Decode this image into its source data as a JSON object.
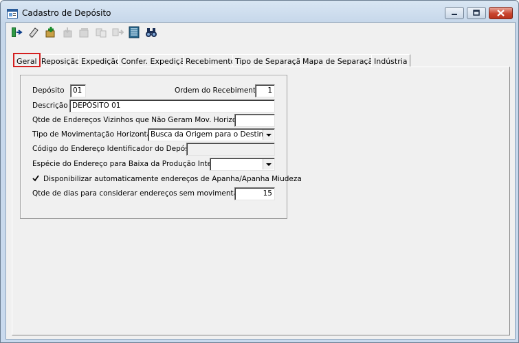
{
  "window": {
    "title": "Cadastro de Depósito"
  },
  "toolbar": {
    "buttons": [
      {
        "icon": "exit-door-icon",
        "enabled": true
      },
      {
        "icon": "eraser-icon",
        "enabled": true
      },
      {
        "icon": "new-record-icon",
        "enabled": true
      },
      {
        "icon": "save-icon",
        "enabled": false
      },
      {
        "icon": "cancel-edit-icon",
        "enabled": false
      },
      {
        "icon": "copy-icon",
        "enabled": false
      },
      {
        "icon": "delete-icon",
        "enabled": false
      },
      {
        "icon": "grid-list-icon",
        "enabled": true
      },
      {
        "icon": "binoculars-icon",
        "enabled": true
      }
    ]
  },
  "tabs": [
    "Geral",
    "Reposição",
    "Expedição",
    "Confer. Expedição",
    "Recebimento",
    "Tipo de Separação",
    "Mapa de Separação",
    "Indústria"
  ],
  "active_tab": "Geral",
  "form": {
    "deposito_label": "Depósito",
    "deposito_value": "01",
    "ordem_label": "Ordem do Recebimento",
    "ordem_value": "1",
    "descricao_label": "Descrição",
    "descricao_value": "DEPÓSITO 01",
    "qtde_vizinhos_label": "Qtde de Endereços Vizinhos que Não Geram Mov. Horizontal",
    "qtde_vizinhos_value": "",
    "tipo_mov_label": "Tipo de Movimentação Horizontal",
    "tipo_mov_value": "Busca da Origem para o Destino",
    "codigo_end_label": "Código do Endereço Identificador do Depósito",
    "codigo_end_value": "",
    "especie_label": "Espécie do Endereço para Baixa da Produção Interna",
    "especie_value": "",
    "disponibilizar_label": "Disponibilizar automaticamente endereços de Apanha/Apanha Miudeza",
    "disponibilizar_checked": true,
    "qtde_dias_label": "Qtde de dias para considerar endereços sem movimentação",
    "qtde_dias_value": "15"
  }
}
